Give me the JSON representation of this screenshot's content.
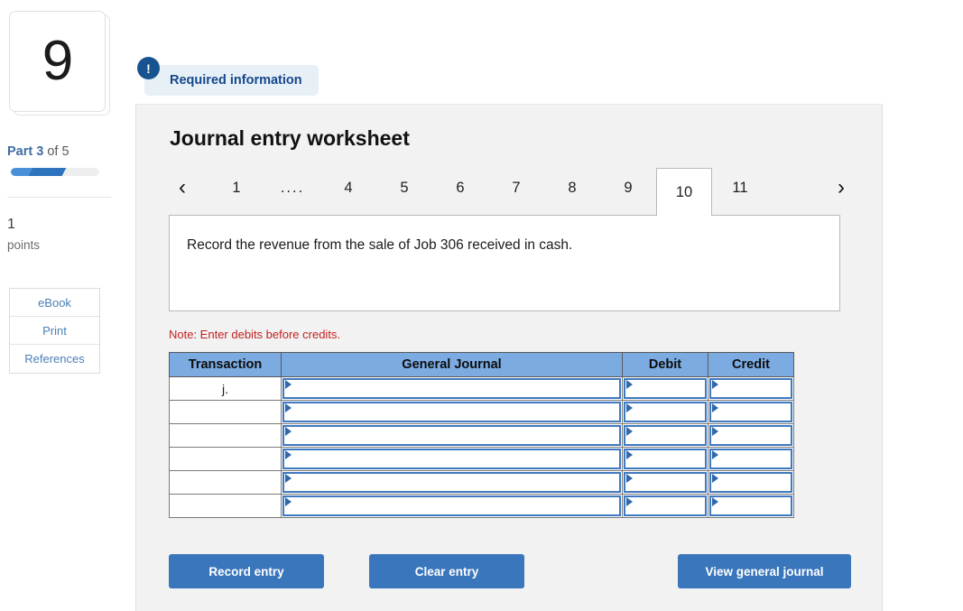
{
  "rail": {
    "question_number": "9",
    "part_prefix": "Part",
    "part_current": "3",
    "part_of": "of 5",
    "progress_percent": 58,
    "points_value": "1",
    "points_label": "points",
    "buttons": [
      {
        "label": "eBook",
        "name": "ebook-button"
      },
      {
        "label": "Print",
        "name": "print-button"
      },
      {
        "label": "References",
        "name": "references-button"
      }
    ]
  },
  "required_banner": {
    "badge_glyph": "!",
    "text": "Required information",
    "badge_color": "#17538f",
    "pill_color": "#e8f0f7"
  },
  "panel": {
    "title": "Journal entry worksheet",
    "prev_arrow": "‹",
    "next_arrow": "›",
    "tabs": [
      {
        "label": "1",
        "active": false
      },
      {
        "label": "....",
        "active": false
      },
      {
        "label": "4",
        "active": false
      },
      {
        "label": "5",
        "active": false
      },
      {
        "label": "6",
        "active": false
      },
      {
        "label": "7",
        "active": false
      },
      {
        "label": "8",
        "active": false
      },
      {
        "label": "9",
        "active": false
      },
      {
        "label": "10",
        "active": true
      },
      {
        "label": "11",
        "active": false
      }
    ],
    "prompt": "Record the revenue from the sale of Job 306 received in cash.",
    "note": "Note: Enter debits before credits."
  },
  "table": {
    "headers": [
      "Transaction",
      "General Journal",
      "Debit",
      "Credit"
    ],
    "header_color": "#7cabe2",
    "rows": [
      {
        "transaction": "j.",
        "general_journal": "",
        "debit": "",
        "credit": ""
      },
      {
        "transaction": "",
        "general_journal": "",
        "debit": "",
        "credit": ""
      },
      {
        "transaction": "",
        "general_journal": "",
        "debit": "",
        "credit": ""
      },
      {
        "transaction": "",
        "general_journal": "",
        "debit": "",
        "credit": ""
      },
      {
        "transaction": "",
        "general_journal": "",
        "debit": "",
        "credit": ""
      },
      {
        "transaction": "",
        "general_journal": "",
        "debit": "",
        "credit": ""
      }
    ]
  },
  "actions": {
    "record_label": "Record entry",
    "clear_label": "Clear entry",
    "view_label": "View general journal",
    "button_color": "#3a76bc"
  }
}
